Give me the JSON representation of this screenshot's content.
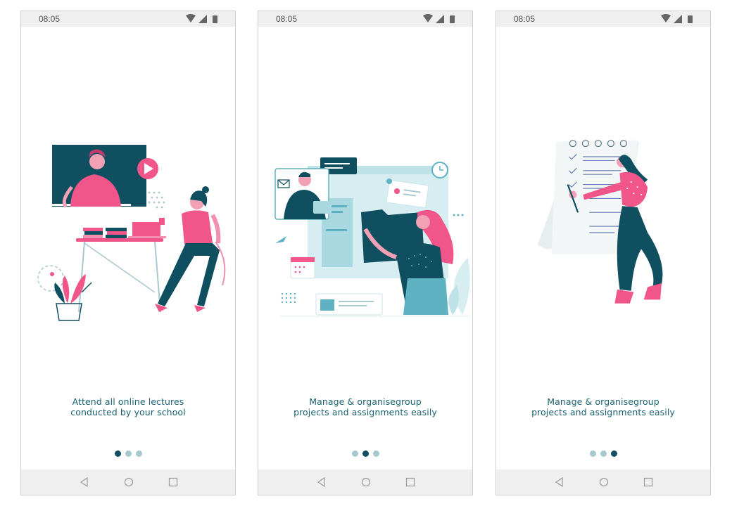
{
  "screens": [
    {
      "time": "08:05",
      "caption_line1": "Attend all online lectures",
      "caption_line2": "conducted by your school",
      "active_dot": 0
    },
    {
      "time": "08:05",
      "caption_line1": "Manage & organisegroup",
      "caption_line2": "projects and assignments easily",
      "active_dot": 1
    },
    {
      "time": "08:05",
      "caption_line1": "Manage & organisegroup",
      "caption_line2": "projects and assignments easily",
      "active_dot": 2
    }
  ],
  "icons": {
    "status": [
      "wifi-icon",
      "signal-icon",
      "battery-icon"
    ],
    "nav": [
      "back-icon",
      "home-icon",
      "recents-icon"
    ]
  },
  "colors": {
    "accent": "#0f4f60",
    "pink": "#f0568a",
    "teal": "#1a6270",
    "dot_inactive": "#a9c8cf"
  }
}
